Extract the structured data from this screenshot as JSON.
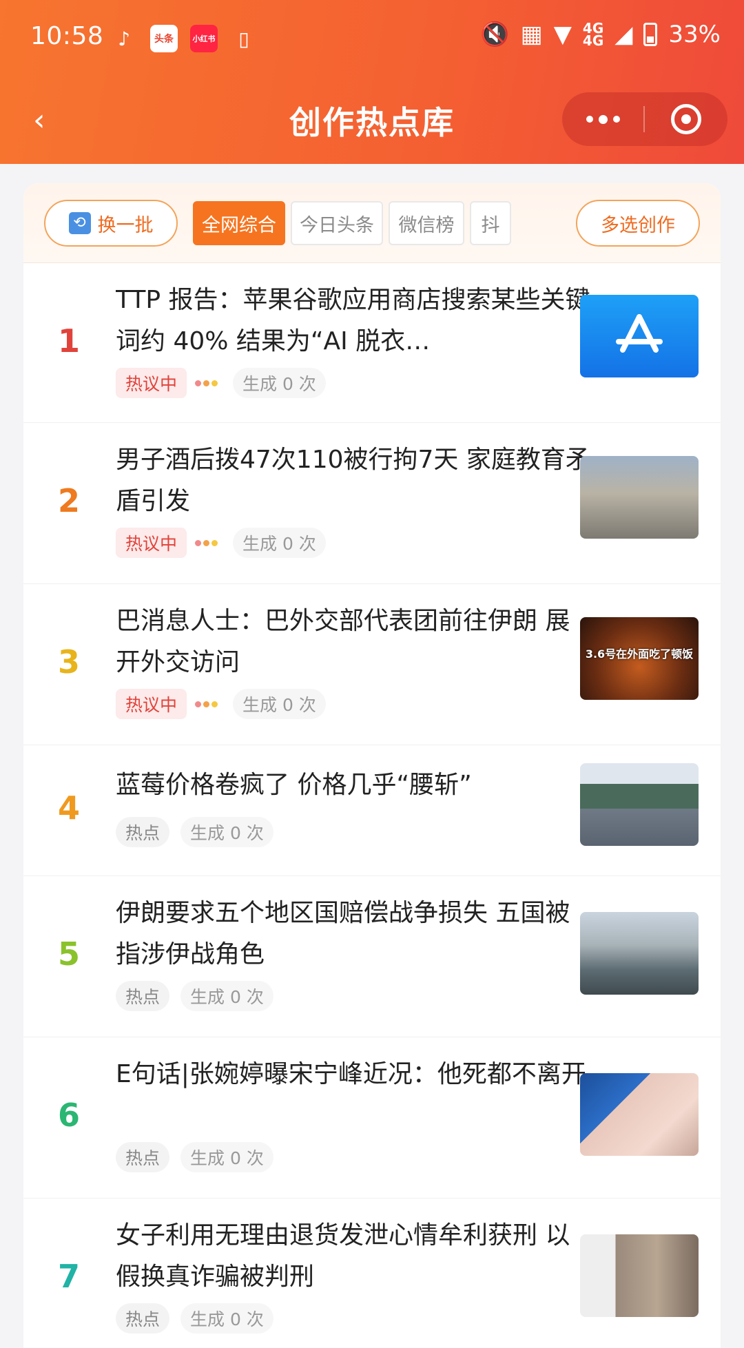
{
  "status_bar": {
    "time": "10:58",
    "apps": [
      {
        "icon": "tiktok-icon",
        "glyph": "♪"
      },
      {
        "icon": "toutiao-icon",
        "glyph": "头条"
      },
      {
        "icon": "xiaohongshu-icon",
        "glyph": "小红书"
      },
      {
        "icon": "phone-icon",
        "glyph": "▯"
      }
    ],
    "network_label": "4G",
    "network_label_2": "4G",
    "battery": "33%"
  },
  "nav": {
    "title": "创作热点库",
    "back_icon": "chevron-left-icon"
  },
  "filter": {
    "refresh_label": "换一批",
    "tabs": [
      "全网综合",
      "今日头条",
      "微信榜",
      "抖"
    ],
    "active_tab": "全网综合",
    "multi_label": "多选创作"
  },
  "colors": {
    "accent": "#f6741f",
    "hot_tag": "#e0433b"
  },
  "items": [
    {
      "rank": "1",
      "rank_color": "#e0433b",
      "title": "TTP 报告：苹果谷歌应用商店搜索某些关键词约 40% 结果为“AI 脱衣…",
      "tag": "热议中",
      "gen": "生成 0 次",
      "thumb": "app-store-icon"
    },
    {
      "rank": "2",
      "rank_color": "#ef7a1f",
      "title": "男子酒后拨47次110被行拘7天 家庭教育矛盾引发",
      "tag": "热议中",
      "gen": "生成 0 次",
      "thumb": "city-aerial-image"
    },
    {
      "rank": "3",
      "rank_color": "#e8b41c",
      "title": "巴消息人士：巴外交部代表团前往伊朗 展开外交访问",
      "tag": "热议中",
      "gen": "生成 0 次",
      "thumb": "crab-dinner-image",
      "thumb_caption": "3.6号在外面吃了顿饭"
    },
    {
      "rank": "4",
      "rank_color": "#ef9a1f",
      "title": "蓝莓价格卷疯了 价格几乎“腰斩”",
      "tag": "热点",
      "gen": "生成 0 次",
      "thumb": "cargo-ship-image"
    },
    {
      "rank": "5",
      "rank_color": "#8ac22c",
      "title": "伊朗要求五个地区国赔偿战争损失 五国被指涉伊战角色",
      "tag": "热点",
      "gen": "生成 0 次",
      "thumb": "street-scene-image"
    },
    {
      "rank": "6",
      "rank_color": "#2bb673",
      "title": "E句话|张婉婷曝宋宁峰近况：他死都不离开",
      "tag": "热点",
      "gen": "生成 0 次",
      "thumb": "baby-image"
    },
    {
      "rank": "7",
      "rank_color": "#20b3a6",
      "title": "女子利用无理由退货发泄心情牟利获刑 以假换真诈骗被判刑",
      "tag": "热点",
      "gen": "生成 0 次",
      "thumb": "ambulance-scene-image"
    }
  ]
}
